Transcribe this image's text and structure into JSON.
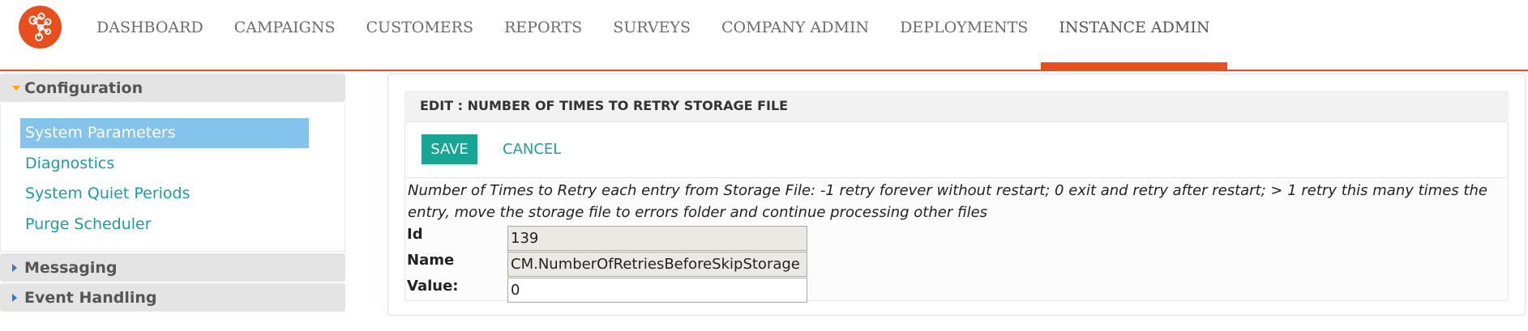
{
  "colors": {
    "accent": "#ea4e1c",
    "teal": "#17a594",
    "link": "#1b9e9e",
    "selected_bg": "#84c3eb"
  },
  "nav": {
    "logo_icon": "network-nodes-icon",
    "items": [
      {
        "label": "DASHBOARD"
      },
      {
        "label": "CAMPAIGNS"
      },
      {
        "label": "CUSTOMERS"
      },
      {
        "label": "REPORTS"
      },
      {
        "label": "SURVEYS"
      },
      {
        "label": "COMPANY ADMIN"
      },
      {
        "label": "DEPLOYMENTS"
      },
      {
        "label": "INSTANCE ADMIN",
        "active": true
      }
    ]
  },
  "sidebar": {
    "sections": [
      {
        "label": "Configuration",
        "expanded": true,
        "items": [
          {
            "label": "System Parameters",
            "selected": true
          },
          {
            "label": "Diagnostics"
          },
          {
            "label": "System Quiet Periods"
          },
          {
            "label": "Purge Scheduler"
          }
        ]
      },
      {
        "label": "Messaging",
        "expanded": false
      },
      {
        "label": "Event Handling",
        "expanded": false
      }
    ]
  },
  "edit": {
    "title": "EDIT : NUMBER OF TIMES TO RETRY STORAGE FILE",
    "save_label": "SAVE",
    "cancel_label": "CANCEL",
    "description": "Number of Times to Retry each entry from Storage File: -1 retry forever without restart; 0 exit and retry after restart; > 1 retry this many times the entry, move the storage file to errors folder and continue processing other files",
    "fields": {
      "id": {
        "label": "Id",
        "value": "139"
      },
      "name": {
        "label": "Name",
        "value": "CM.NumberOfRetriesBeforeSkipStorage"
      },
      "value": {
        "label": "Value:",
        "value": "0"
      }
    }
  }
}
